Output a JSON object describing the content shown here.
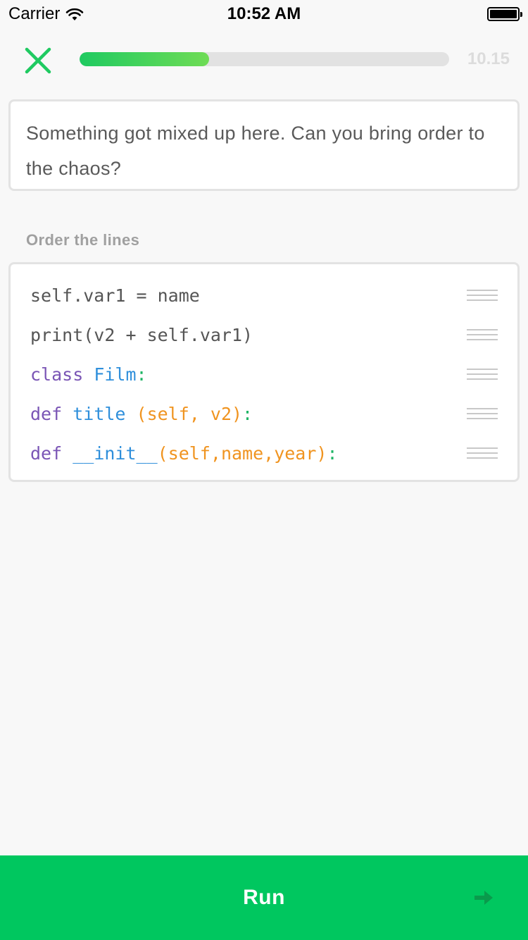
{
  "status_bar": {
    "carrier": "Carrier",
    "time": "10:52 AM"
  },
  "top_bar": {
    "close_icon": "close-x-icon",
    "progress_fraction": 0.35,
    "progress_value": "10.15"
  },
  "prompt": {
    "text": "Something got mixed up here. Can you bring order to the chaos?"
  },
  "section": {
    "label": "Order the lines"
  },
  "code_lines": [
    {
      "parts": [
        {
          "text": "self.var1 = name",
          "style": "plain"
        }
      ]
    },
    {
      "parts": [
        {
          "text": "print(v2 + self.var1)",
          "style": "plain"
        }
      ]
    },
    {
      "parts": [
        {
          "text": "class ",
          "style": "kw"
        },
        {
          "text": "Film",
          "style": "fn"
        },
        {
          "text": ":",
          "style": "punct"
        }
      ]
    },
    {
      "parts": [
        {
          "text": "def ",
          "style": "kw"
        },
        {
          "text": "title ",
          "style": "fn"
        },
        {
          "text": "(self, v2)",
          "style": "args"
        },
        {
          "text": ":",
          "style": "punct"
        }
      ]
    },
    {
      "parts": [
        {
          "text": "def ",
          "style": "kw"
        },
        {
          "text": "__init__",
          "style": "fn"
        },
        {
          "text": "(self,name,year)",
          "style": "args"
        },
        {
          "text": ":",
          "style": "punct"
        }
      ]
    }
  ],
  "footer": {
    "run_label": "Run",
    "arrow_icon": "arrow-right-icon"
  },
  "colors": {
    "accent_green": "#00c75f",
    "keyword": "#7a55b5",
    "function": "#2f8fdb",
    "args": "#f09420",
    "punctuation": "#1fb566"
  }
}
